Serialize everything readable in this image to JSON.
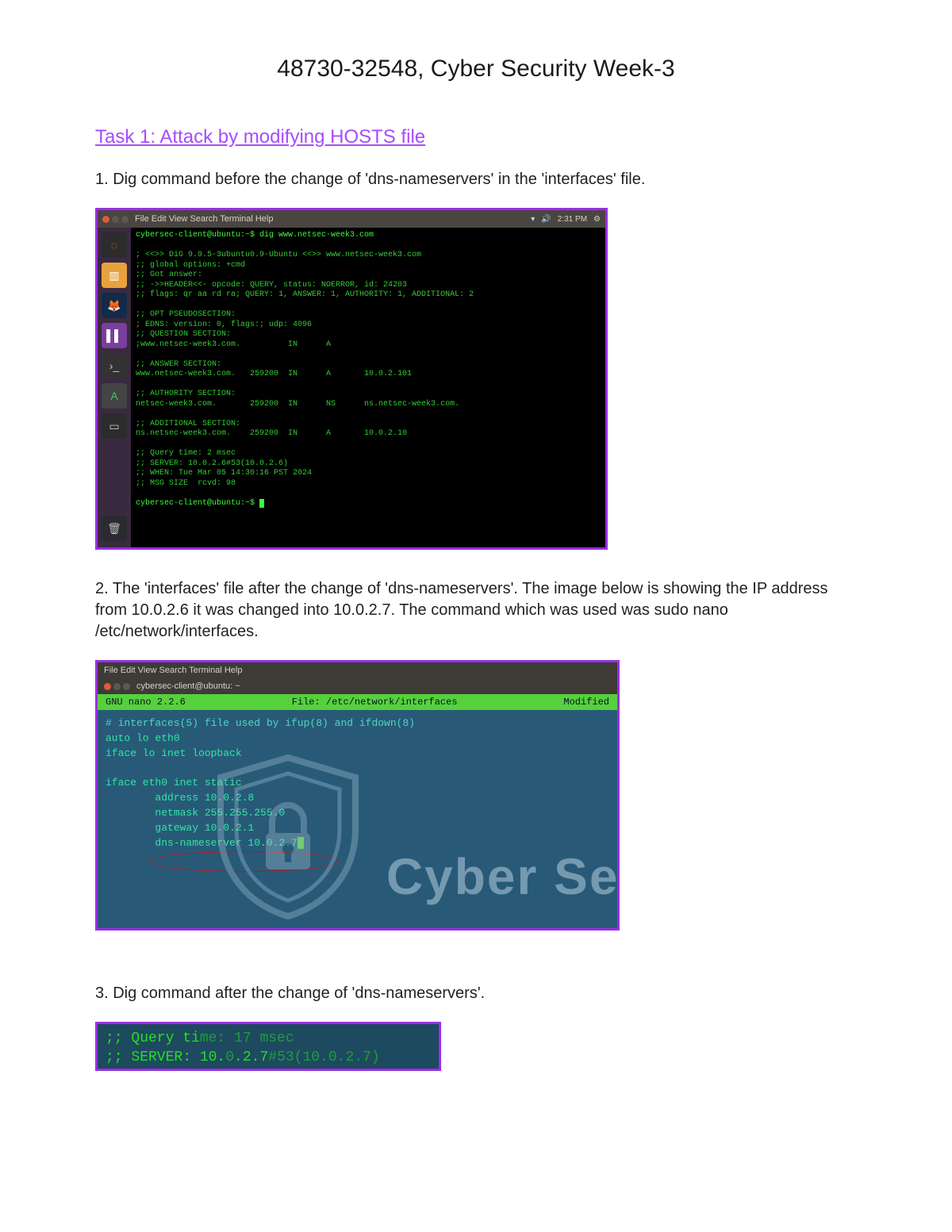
{
  "title": "48730-32548, Cyber Security Week-3",
  "task_heading": "Task 1: Attack by modifying HOSTS file",
  "para1": "1. Dig command before the change of 'dns-nameservers' in the 'interfaces' file.",
  "para2": "2. The 'interfaces' file after the change of 'dns-nameservers'. The image below is showing the IP address from 10.0.2.6 it was changed into 10.0.2.7. The command which was used was sudo nano /etc/network/interfaces.",
  "para3": "3. Dig command after the change of 'dns-nameservers'.",
  "shot1": {
    "menubar": "File  Edit  View  Search  Terminal  Help",
    "sys_time": "2:31 PM",
    "prompt1": "cybersec-client@ubuntu:~$ dig www.netsec-week3.com",
    "dig_body": "; <<>> DiG 9.9.5-3ubuntu0.9-Ubuntu <<>> www.netsec-week3.com\n;; global options: +cmd\n;; Got answer:\n;; ->>HEADER<<- opcode: QUERY, status: NOERROR, id: 24203\n;; flags: qr aa rd ra; QUERY: 1, ANSWER: 1, AUTHORITY: 1, ADDITIONAL: 2\n\n;; OPT PSEUDOSECTION:\n; EDNS: version: 0, flags:; udp: 4096\n;; QUESTION SECTION:\n;www.netsec-week3.com.          IN      A\n\n;; ANSWER SECTION:\nwww.netsec-week3.com.   259200  IN      A       10.0.2.101\n\n;; AUTHORITY SECTION:\nnetsec-week3.com.       259200  IN      NS      ns.netsec-week3.com.\n\n;; ADDITIONAL SECTION:\nns.netsec-week3.com.    259200  IN      A       10.0.2.10\n\n;; Query time: 2 msec\n;; SERVER: 10.0.2.6#53(10.0.2.6)\n;; WHEN: Tue Mar 05 14:30:16 PST 2024\n;; MSG SIZE  rcvd: 98",
    "prompt2": "cybersec-client@ubuntu:~$ "
  },
  "shot2": {
    "menubar": "File  Edit  View  Search  Terminal  Help",
    "tab_title": "cybersec-client@ubuntu: ~",
    "nano_left": "GNU nano 2.2.6",
    "nano_center": "File: /etc/network/interfaces",
    "nano_right": "Modified",
    "body_comment": "# interfaces(5) file used by ifup(8) and ifdown(8)",
    "body_lines": "auto lo eth0\niface lo inet loopback\n\niface eth0 inet static\n        address 10.0.2.8\n        netmask 255.255.255.0\n        gateway 10.0.2.1\n        dns-nameserver 10.0.2.7",
    "watermark": "Cyber Sec"
  },
  "shot3": {
    "line1_a": ";; Query ti",
    "line1_b": "me: 17 msec",
    "line2_a": ";; SERVER: 10.",
    "line2_b": "0.2.7#53(10.0.2.7)"
  }
}
